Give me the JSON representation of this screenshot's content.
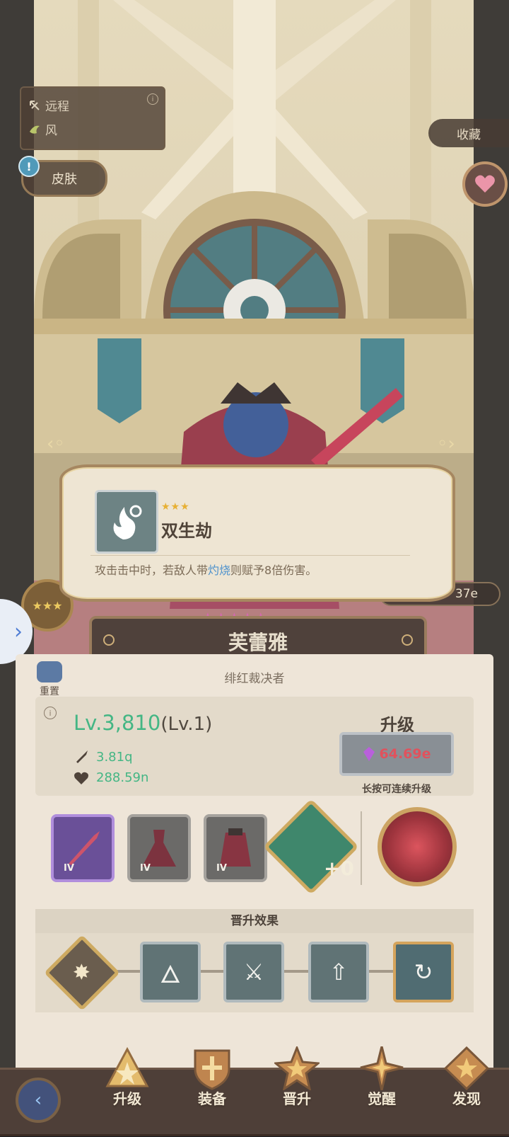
{
  "type_card": {
    "range_label": "远程",
    "element_label": "风"
  },
  "skin_button": {
    "label": "皮肤",
    "alert": "!"
  },
  "favorite_button": {
    "label": "收藏"
  },
  "tooltip": {
    "stars": "★★★",
    "title": "双生劫",
    "desc_before": "攻击击中时，若敌人带",
    "desc_keyword": "灼烧",
    "desc_after": "则赋予8倍伤害。"
  },
  "power_pill": {
    "value": "37e"
  },
  "hero": {
    "name": "芙蕾雅",
    "subtitle": "绯红裁决者",
    "rank_stars": "★★★★★"
  },
  "reset_button": {
    "label": "重置"
  },
  "stats": {
    "level": "Lv.3,810",
    "level_sub": "(Lv.1)",
    "attack": "3.81q",
    "hp": "288.59n"
  },
  "upgrade": {
    "title": "升级",
    "cost": "64.69e",
    "hint": "长按可连续升级"
  },
  "equipment": {
    "weapon_tier": "IV",
    "dress_tier": "IV",
    "cape_tier": "IV",
    "rune_plus": "+0"
  },
  "promotion": {
    "header": "晋升效果"
  },
  "nav": {
    "upgrade": "升级",
    "equip": "装备",
    "promote": "晋升",
    "awaken": "觉醒",
    "discover": "发现"
  },
  "colors": {
    "accent_green": "#2fae77",
    "cost_red": "#dd3f4b",
    "keyword_blue": "#3c86c7",
    "panel_bg": "#ece3d4",
    "nav_bg": "#3a2a22"
  },
  "icons": {
    "range": "bow-icon",
    "element": "wind-icon",
    "heart": "heart-icon",
    "skill": "flame-icon",
    "attack": "sword-icon",
    "hp": "heart-plus-icon",
    "currency": "crystal-icon",
    "back": "back-arrow-icon"
  }
}
